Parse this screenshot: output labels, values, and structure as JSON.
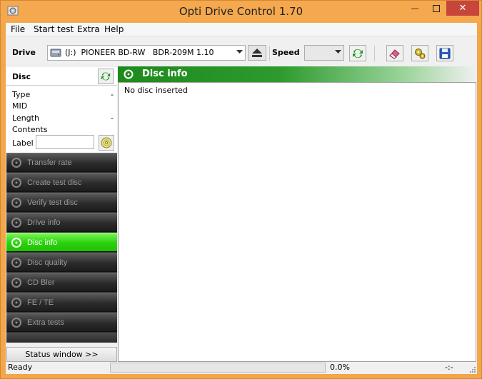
{
  "window": {
    "title": "Opti Drive Control 1.70",
    "minimize_glyph": "—",
    "close_glyph": "✕"
  },
  "menu": [
    "File",
    "Start test",
    "Extra",
    "Help"
  ],
  "toolbar": {
    "drive_label": "Drive",
    "drive_value": "(J:)  PIONEER BD-RW   BDR-209M 1.10",
    "speed_label": "Speed",
    "speed_value": "",
    "icons": [
      "refresh-arrows-icon",
      "eraser-icon",
      "settings-gears-icon",
      "save-floppy-icon"
    ]
  },
  "disc_panel": {
    "title": "Disc",
    "properties": [
      {
        "label": "Type",
        "value": "-"
      },
      {
        "label": "MID",
        "value": ""
      },
      {
        "label": "Length",
        "value": "-"
      },
      {
        "label": "Contents",
        "value": ""
      }
    ],
    "label_field": {
      "label": "Label",
      "value": ""
    }
  },
  "nav": {
    "items": [
      {
        "label": "Transfer rate",
        "active": false
      },
      {
        "label": "Create test disc",
        "active": false
      },
      {
        "label": "Verify test disc",
        "active": false
      },
      {
        "label": "Drive info",
        "active": false
      },
      {
        "label": "Disc info",
        "active": true
      },
      {
        "label": "Disc quality",
        "active": false
      },
      {
        "label": "CD Bler",
        "active": false
      },
      {
        "label": "FE / TE",
        "active": false
      },
      {
        "label": "Extra tests",
        "active": false
      }
    ],
    "status_window_button": "Status window >>"
  },
  "content": {
    "header_title": "Disc info",
    "message": "No disc inserted"
  },
  "statusbar": {
    "status": "Ready",
    "progress": 0.0,
    "progress_text": "0.0%",
    "time": "-:-"
  },
  "colors": {
    "title_bar": "#f5a84e",
    "nav_active": "#2dd40f",
    "content_header": "#1e8a1e",
    "close_button": "#c7453a"
  }
}
